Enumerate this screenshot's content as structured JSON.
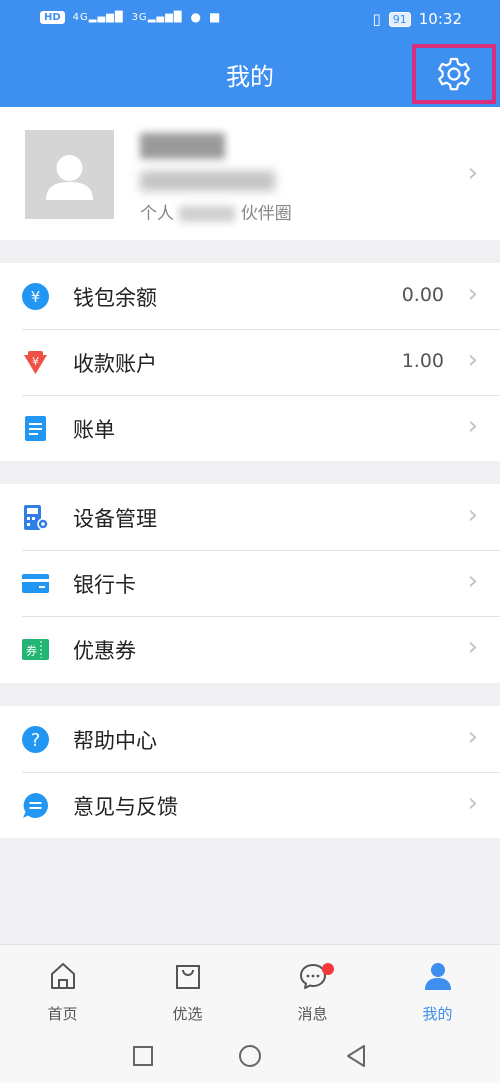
{
  "status_bar": {
    "network_badge": "HD",
    "signal_1": "4G",
    "signal_2": "3G",
    "battery": "91",
    "time": "10:32"
  },
  "header": {
    "title": "我的"
  },
  "profile": {
    "link_prefix": "个人",
    "link_suffix": "伙伴圈"
  },
  "menu": {
    "wallet_balance": {
      "label": "钱包余额",
      "value": "0.00"
    },
    "payment_account": {
      "label": "收款账户",
      "value": "1.00"
    },
    "bill": {
      "label": "账单"
    },
    "device_management": {
      "label": "设备管理"
    },
    "bank_card": {
      "label": "银行卡"
    },
    "coupon": {
      "label": "优惠券",
      "icon_text": "券"
    },
    "help_center": {
      "label": "帮助中心"
    },
    "feedback": {
      "label": "意见与反馈"
    }
  },
  "icons": {
    "yen_symbol": "¥",
    "help_symbol": "?"
  },
  "tabs": [
    {
      "label": "首页"
    },
    {
      "label": "优选"
    },
    {
      "label": "消息"
    },
    {
      "label": "我的"
    }
  ],
  "colors": {
    "primary": "#3d8ff0",
    "highlight_border": "#d6307d",
    "badge_red": "#f23a3a"
  }
}
